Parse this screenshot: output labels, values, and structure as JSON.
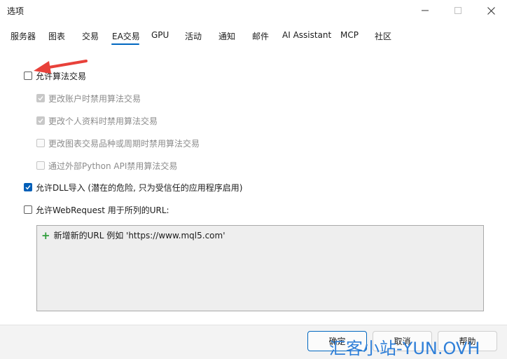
{
  "window": {
    "title": "选项",
    "minimize_icon": "minimize-icon",
    "maximize_icon": "maximize-icon",
    "close_icon": "close-icon"
  },
  "tabs": [
    {
      "label": "服务器",
      "active": false
    },
    {
      "label": "图表",
      "active": false
    },
    {
      "label": "交易",
      "active": false
    },
    {
      "label": "EA交易",
      "active": true
    },
    {
      "label": "GPU",
      "active": false
    },
    {
      "label": "活动",
      "active": false
    },
    {
      "label": "通知",
      "active": false
    },
    {
      "label": "邮件",
      "active": false
    },
    {
      "label": "AI Assistant",
      "active": false
    },
    {
      "label": "MCP",
      "active": false
    },
    {
      "label": "社区",
      "active": false
    }
  ],
  "options": {
    "allow_algo_trading": {
      "label": "允许算法交易",
      "checked": false,
      "enabled": true
    },
    "disable_on_account_change": {
      "label": "更改账户时禁用算法交易",
      "checked": true,
      "enabled": false
    },
    "disable_on_profile_change": {
      "label": "更改个人资料时禁用算法交易",
      "checked": true,
      "enabled": false
    },
    "disable_on_symbol_change": {
      "label": "更改图表交易品种或周期时禁用算法交易",
      "checked": false,
      "enabled": false
    },
    "disable_via_python": {
      "label": "通过外部Python API禁用算法交易",
      "checked": false,
      "enabled": false
    },
    "allow_dll": {
      "label": "允许DLL导入 (潜在的危险, 只为受信任的应用程序启用)",
      "checked": true,
      "enabled": true
    },
    "allow_webrequest": {
      "label": "允许WebRequest 用于所列的URL:",
      "checked": false,
      "enabled": true
    }
  },
  "url_list": {
    "add_label": "新增新的URL 例如 'https://www.mql5.com'",
    "add_icon": "plus-icon"
  },
  "buttons": {
    "ok": "确定",
    "cancel": "取消",
    "help": "帮助"
  },
  "watermark": "汇客小站-YUN.OVH",
  "colors": {
    "accent": "#005fb8",
    "tab_underline": "#0067c0",
    "annotation_arrow": "#e8413a",
    "plus": "#2e9d3a",
    "watermark": "#2f7fd8"
  }
}
